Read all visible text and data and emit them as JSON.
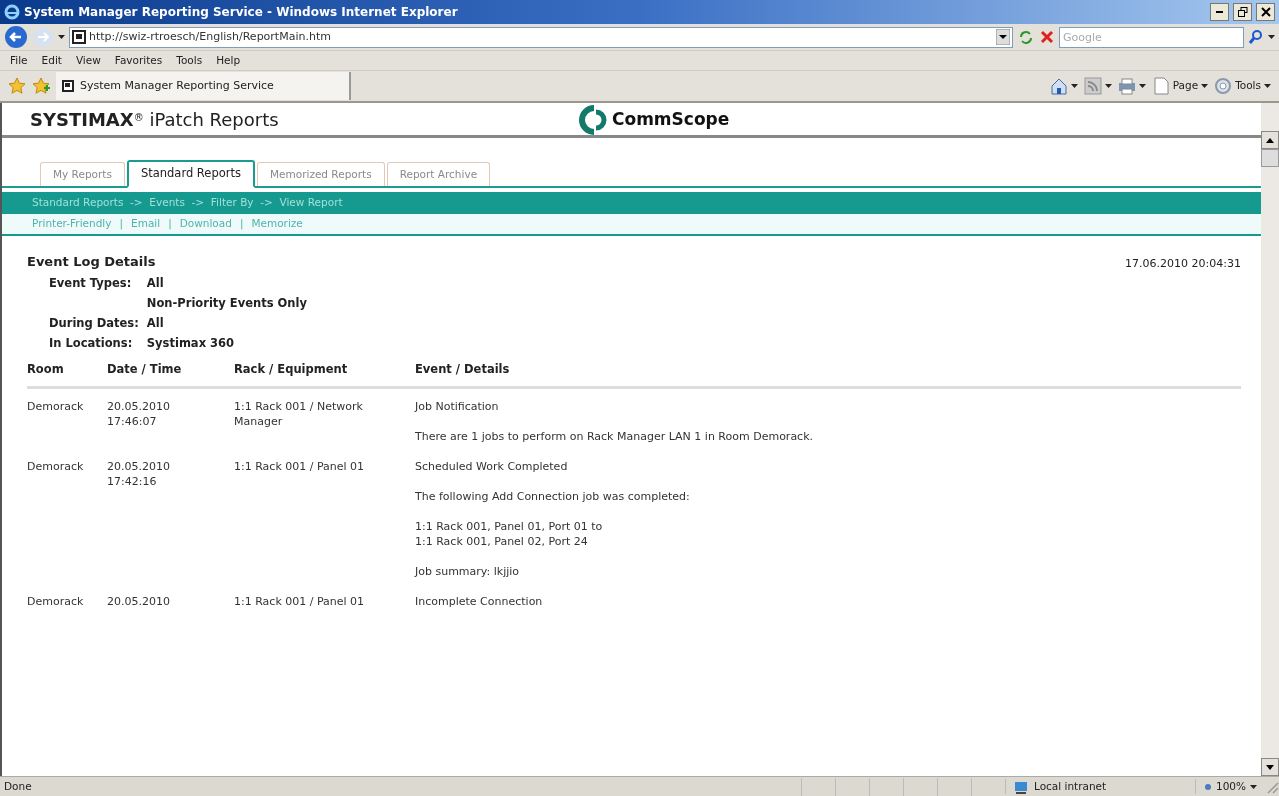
{
  "window": {
    "title": "System Manager Reporting Service - Windows Internet Explorer"
  },
  "address": {
    "url": "http://swiz-rtroesch/English/ReportMain.htm"
  },
  "search": {
    "placeholder": "Google"
  },
  "menu": [
    "File",
    "Edit",
    "View",
    "Favorites",
    "Tools",
    "Help"
  ],
  "favorites_bar": {
    "tab_title": "System Manager Reporting Service"
  },
  "command_bar": [
    {
      "kind": "home"
    },
    {
      "kind": "feeds"
    },
    {
      "kind": "print"
    },
    {
      "kind": "page",
      "label": "Page"
    },
    {
      "kind": "tools",
      "label": "Tools"
    }
  ],
  "header": {
    "title": "**SYSTIMAX**$^{®}$ iPatch Reports",
    "logo_text": "CommScope"
  },
  "tabs": [
    {
      "label": "My Reports",
      "selected": false
    },
    {
      "label": "Standard Reports",
      "selected": true
    },
    {
      "label": "Memorized Reports",
      "selected": false
    },
    {
      "label": "Report Archive",
      "selected": false
    }
  ],
  "breadcrumb": "Standard Reports  ->  Events  ->  Filter By  ->  View Report",
  "actions": {
    "links": [
      "Printer-Friendly",
      "Email",
      "Download",
      "Memorize"
    ],
    "separator": "|"
  },
  "report": {
    "title": "Event Log Details",
    "timestamp": "17.06.2010 20:04:31",
    "filters": [
      {
        "label": "Event Types:",
        "values": [
          "All",
          "Non-Priority Events Only"
        ]
      },
      {
        "label": "During Dates:",
        "values": [
          "All"
        ]
      },
      {
        "label": "In Locations:",
        "values": [
          "Systimax 360"
        ]
      }
    ]
  },
  "table": {
    "columns": [
      "Room",
      "Date / Time",
      "Rack / Equipment",
      "Event / Details"
    ],
    "rows": [
      {
        "room": "Demorack",
        "date_time": [
          "20.05.2010",
          "17:46:07"
        ],
        "rack": "1:1 Rack 001 / Network Manager",
        "details": [
          "Job Notification",
          "There are 1 jobs to perform on Rack Manager LAN 1 in Room Demorack."
        ]
      },
      {
        "room": "Demorack",
        "date_time": [
          "20.05.2010",
          "17:42:16"
        ],
        "rack": "1:1 Rack 001 / Panel 01",
        "details": [
          "Scheduled Work Completed",
          "The following Add Connection job was completed:",
          "1:1 Rack 001, Panel 01, Port 01 to\n1:1 Rack 001, Panel 02, Port 24",
          "Job summary: lkjjio"
        ]
      },
      {
        "room": "Demorack",
        "date_time": [
          "20.05.2010"
        ],
        "rack": "1:1 Rack 001 / Panel 01",
        "details": [
          "Incomplete Connection"
        ]
      }
    ]
  },
  "status_bar": {
    "text": "Done",
    "zone": "Local intranet",
    "zoom": "100%"
  }
}
